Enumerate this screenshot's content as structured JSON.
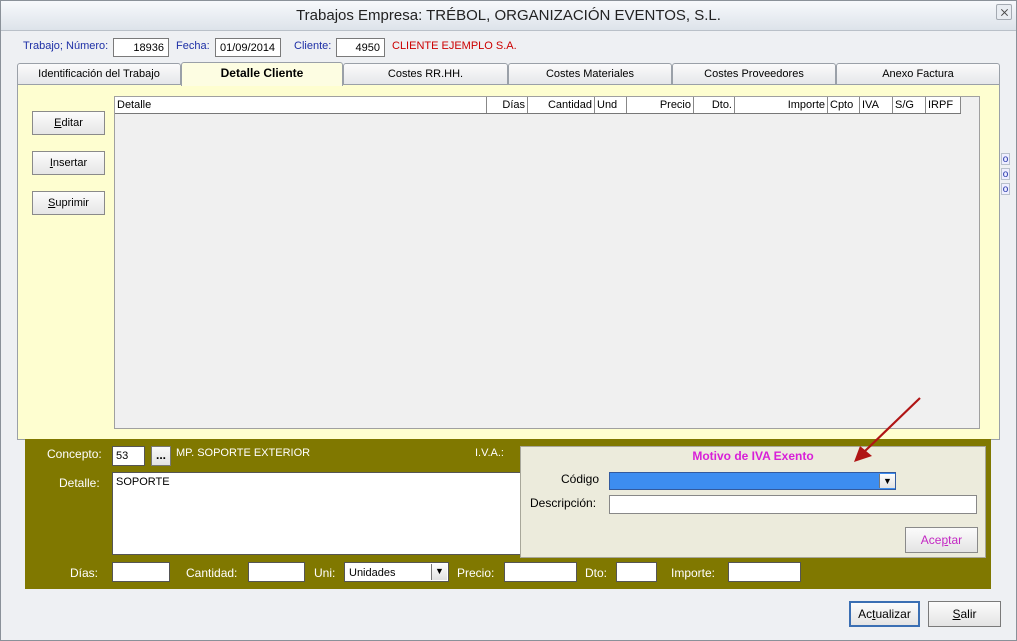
{
  "window": {
    "title": "Trabajos Empresa: TRÉBOL, ORGANIZACIÓN EVENTOS, S.L."
  },
  "header": {
    "trabajo_label": "Trabajo; Número:",
    "trabajo_value": "18936",
    "fecha_label": "Fecha:",
    "fecha_value": "01/09/2014",
    "cliente_label": "Cliente:",
    "cliente_value": "4950",
    "cliente_name": "CLIENTE EJEMPLO S.A."
  },
  "tabs": [
    {
      "label": "Identificación del Trabajo"
    },
    {
      "label": "Detalle Cliente"
    },
    {
      "label": "Costes RR.HH."
    },
    {
      "label": "Costes Materiales"
    },
    {
      "label": "Costes Proveedores"
    },
    {
      "label": "Anexo Factura"
    }
  ],
  "side_buttons": {
    "editar_u": "E",
    "editar_rest": "ditar",
    "insertar_u": "I",
    "insertar_rest": "nsertar",
    "suprimir_u": "S",
    "suprimir_rest": "uprimir"
  },
  "grid": {
    "columns": [
      "Detalle",
      "Días",
      "Cantidad",
      "Und",
      "Precio",
      "Dto.",
      "Importe",
      "Cpto",
      "IVA",
      "S/G",
      "IRPF"
    ]
  },
  "side_markers": [
    "o",
    "o",
    "o"
  ],
  "form": {
    "concepto_label": "Concepto:",
    "concepto_value": "53",
    "concepto_btn": "...",
    "concepto_desc": "MP. SOPORTE EXTERIOR",
    "iva_label": "I.V.A.:",
    "detalle_label": "Detalle:",
    "detalle_value": "SOPORTE",
    "dias_label": "Días:",
    "cantidad_label": "Cantidad:",
    "uni_label": "Uni:",
    "uni_value": "Unidades",
    "precio_label": "Precio:",
    "dto_label": "Dto:",
    "importe_label": "Importe:"
  },
  "dialog": {
    "title": "Motivo de IVA Exento",
    "codigo_label": "Código",
    "descripcion_label": "Descripción:",
    "accept_pre": "Ace",
    "accept_u": "p",
    "accept_post": "tar"
  },
  "footer": {
    "actualizar_pre": "Ac",
    "actualizar_u": "t",
    "actualizar_post": "ualizar",
    "salir_u": "S",
    "salir_rest": "alir"
  },
  "colors": {
    "olive_panel": "#807800",
    "cream_panel": "#fefed0",
    "accent_pink": "#d81fd8",
    "arrow_red": "#b01515"
  }
}
